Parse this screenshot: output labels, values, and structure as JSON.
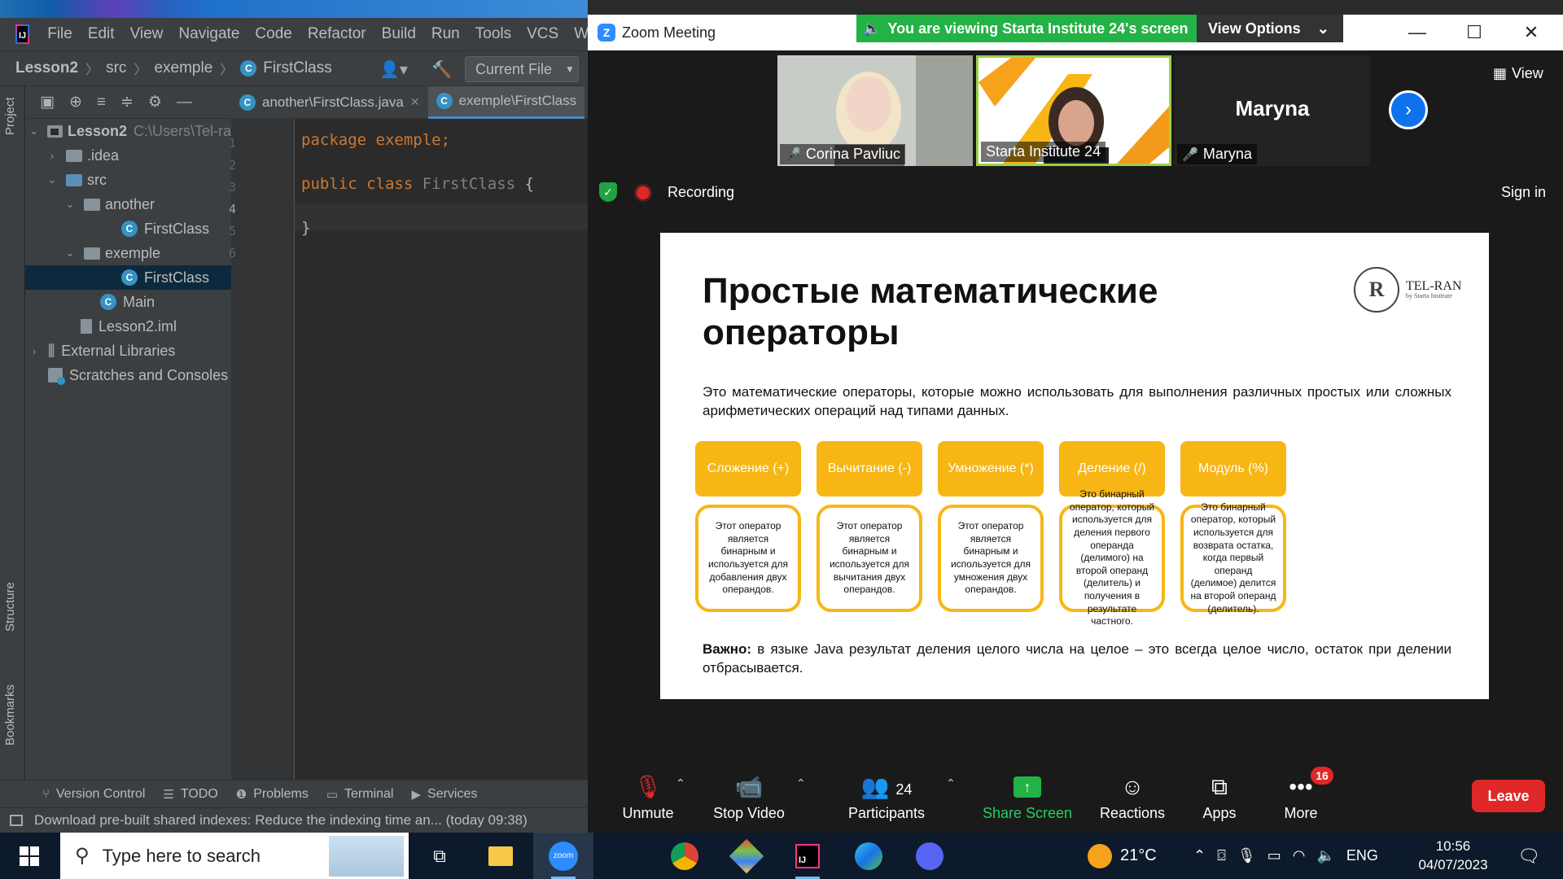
{
  "ide": {
    "logo_text": "IJ",
    "menu": [
      "File",
      "Edit",
      "View",
      "Navigate",
      "Code",
      "Refactor",
      "Build",
      "Run",
      "Tools",
      "VCS",
      "Windo"
    ],
    "breadcrumb": [
      "Lesson2",
      "src",
      "exemple",
      "FirstClass"
    ],
    "run_config": "Current File",
    "side_tabs": {
      "project": "Project",
      "structure": "Structure",
      "bookmarks": "Bookmarks"
    },
    "tree": [
      {
        "label": "Lesson2",
        "hint": "C:\\Users\\Tel-ra",
        "arrow": "⌄"
      },
      {
        "label": ".idea",
        "arrow": "›"
      },
      {
        "label": "src",
        "arrow": "⌄"
      },
      {
        "label": "another",
        "arrow": "⌄"
      },
      {
        "label": "FirstClass"
      },
      {
        "label": "exemple",
        "arrow": "⌄"
      },
      {
        "label": "FirstClass"
      },
      {
        "label": "Main"
      },
      {
        "label": "Lesson2.iml"
      },
      {
        "label": "External Libraries",
        "arrow": "›"
      },
      {
        "label": "Scratches and Consoles"
      }
    ],
    "tabs": [
      {
        "label": "another\\FirstClass.java",
        "close": "✕"
      },
      {
        "label": "exemple\\FirstClass"
      }
    ],
    "line_numbers": [
      "1",
      "2",
      "3",
      "4",
      "5",
      "6"
    ],
    "code": {
      "l1_kw": "package",
      "l1_rest": " exemple;",
      "l3_kw": "public class",
      "l3_name": " FirstClass",
      "l3_brace": " {",
      "l5": "}"
    },
    "tool_tabs": [
      "Version Control",
      "TODO",
      "Problems",
      "Terminal",
      "Services"
    ],
    "status": "Download pre-built shared indexes: Reduce the indexing time an... (today 09:38)"
  },
  "zoom": {
    "title": "Zoom Meeting",
    "banner": "You are viewing Starta Institute 24's screen",
    "view_options": "View Options",
    "participants_tiles": [
      {
        "name": "Corina Pavliuc"
      },
      {
        "name": "Starta Institute 24"
      },
      {
        "name": "Maryna",
        "big_name": "Maryna"
      }
    ],
    "view_label": "View",
    "recording": "Recording",
    "sign_in": "Sign in",
    "controls": {
      "unmute": "Unmute",
      "stop_video": "Stop Video",
      "participants": "Participants",
      "participants_count": "24",
      "share_screen": "Share Screen",
      "reactions": "Reactions",
      "apps": "Apps",
      "more": "More",
      "more_badge": "16",
      "leave": "Leave"
    }
  },
  "slide": {
    "title_line1": "Простые математические",
    "title_line2": "операторы",
    "logo_text": "TEL-RAN",
    "logo_sub": "by Starta Institute",
    "intro": "Это математические операторы, которые можно использовать для выполнения различных простых или сложных арифметических операций над типами данных.",
    "operators": [
      {
        "name": "Сложение (+)",
        "desc": "Этот оператор является бинарным и используется для добавления двух операндов."
      },
      {
        "name": "Вычитание (-)",
        "desc": "Этот оператор является бинарным и используется для вычитания двух операндов."
      },
      {
        "name": "Умножение (*)",
        "desc": "Этот оператор является бинарным и используется для умножения двух операндов."
      },
      {
        "name": "Деление (/)",
        "desc": "Это бинарный оператор, который используется для деления первого операнда (делимого) на второй операнд (делитель) и получения в результате частного."
      },
      {
        "name": "Модуль (%)",
        "desc": "Это бинарный оператор, который используется для возврата остатка, когда первый операнд (делимое) делится на второй операнд (делитель)."
      }
    ],
    "note_bold": "Важно:",
    "note_text": " в языке Java результат деления целого числа на целое – это всегда целое число, остаток при делении отбрасывается."
  },
  "taskbar": {
    "search_placeholder": "Type here to search",
    "zoom_app": "zoom",
    "weather": "21°C",
    "lang": "ENG",
    "time": "10:56",
    "date": "04/07/2023"
  },
  "colors": {
    "accent_green": "#23b245",
    "slide_yellow": "#f7b614",
    "leave_red": "#e02828",
    "zoom_blue": "#0e72ed"
  }
}
